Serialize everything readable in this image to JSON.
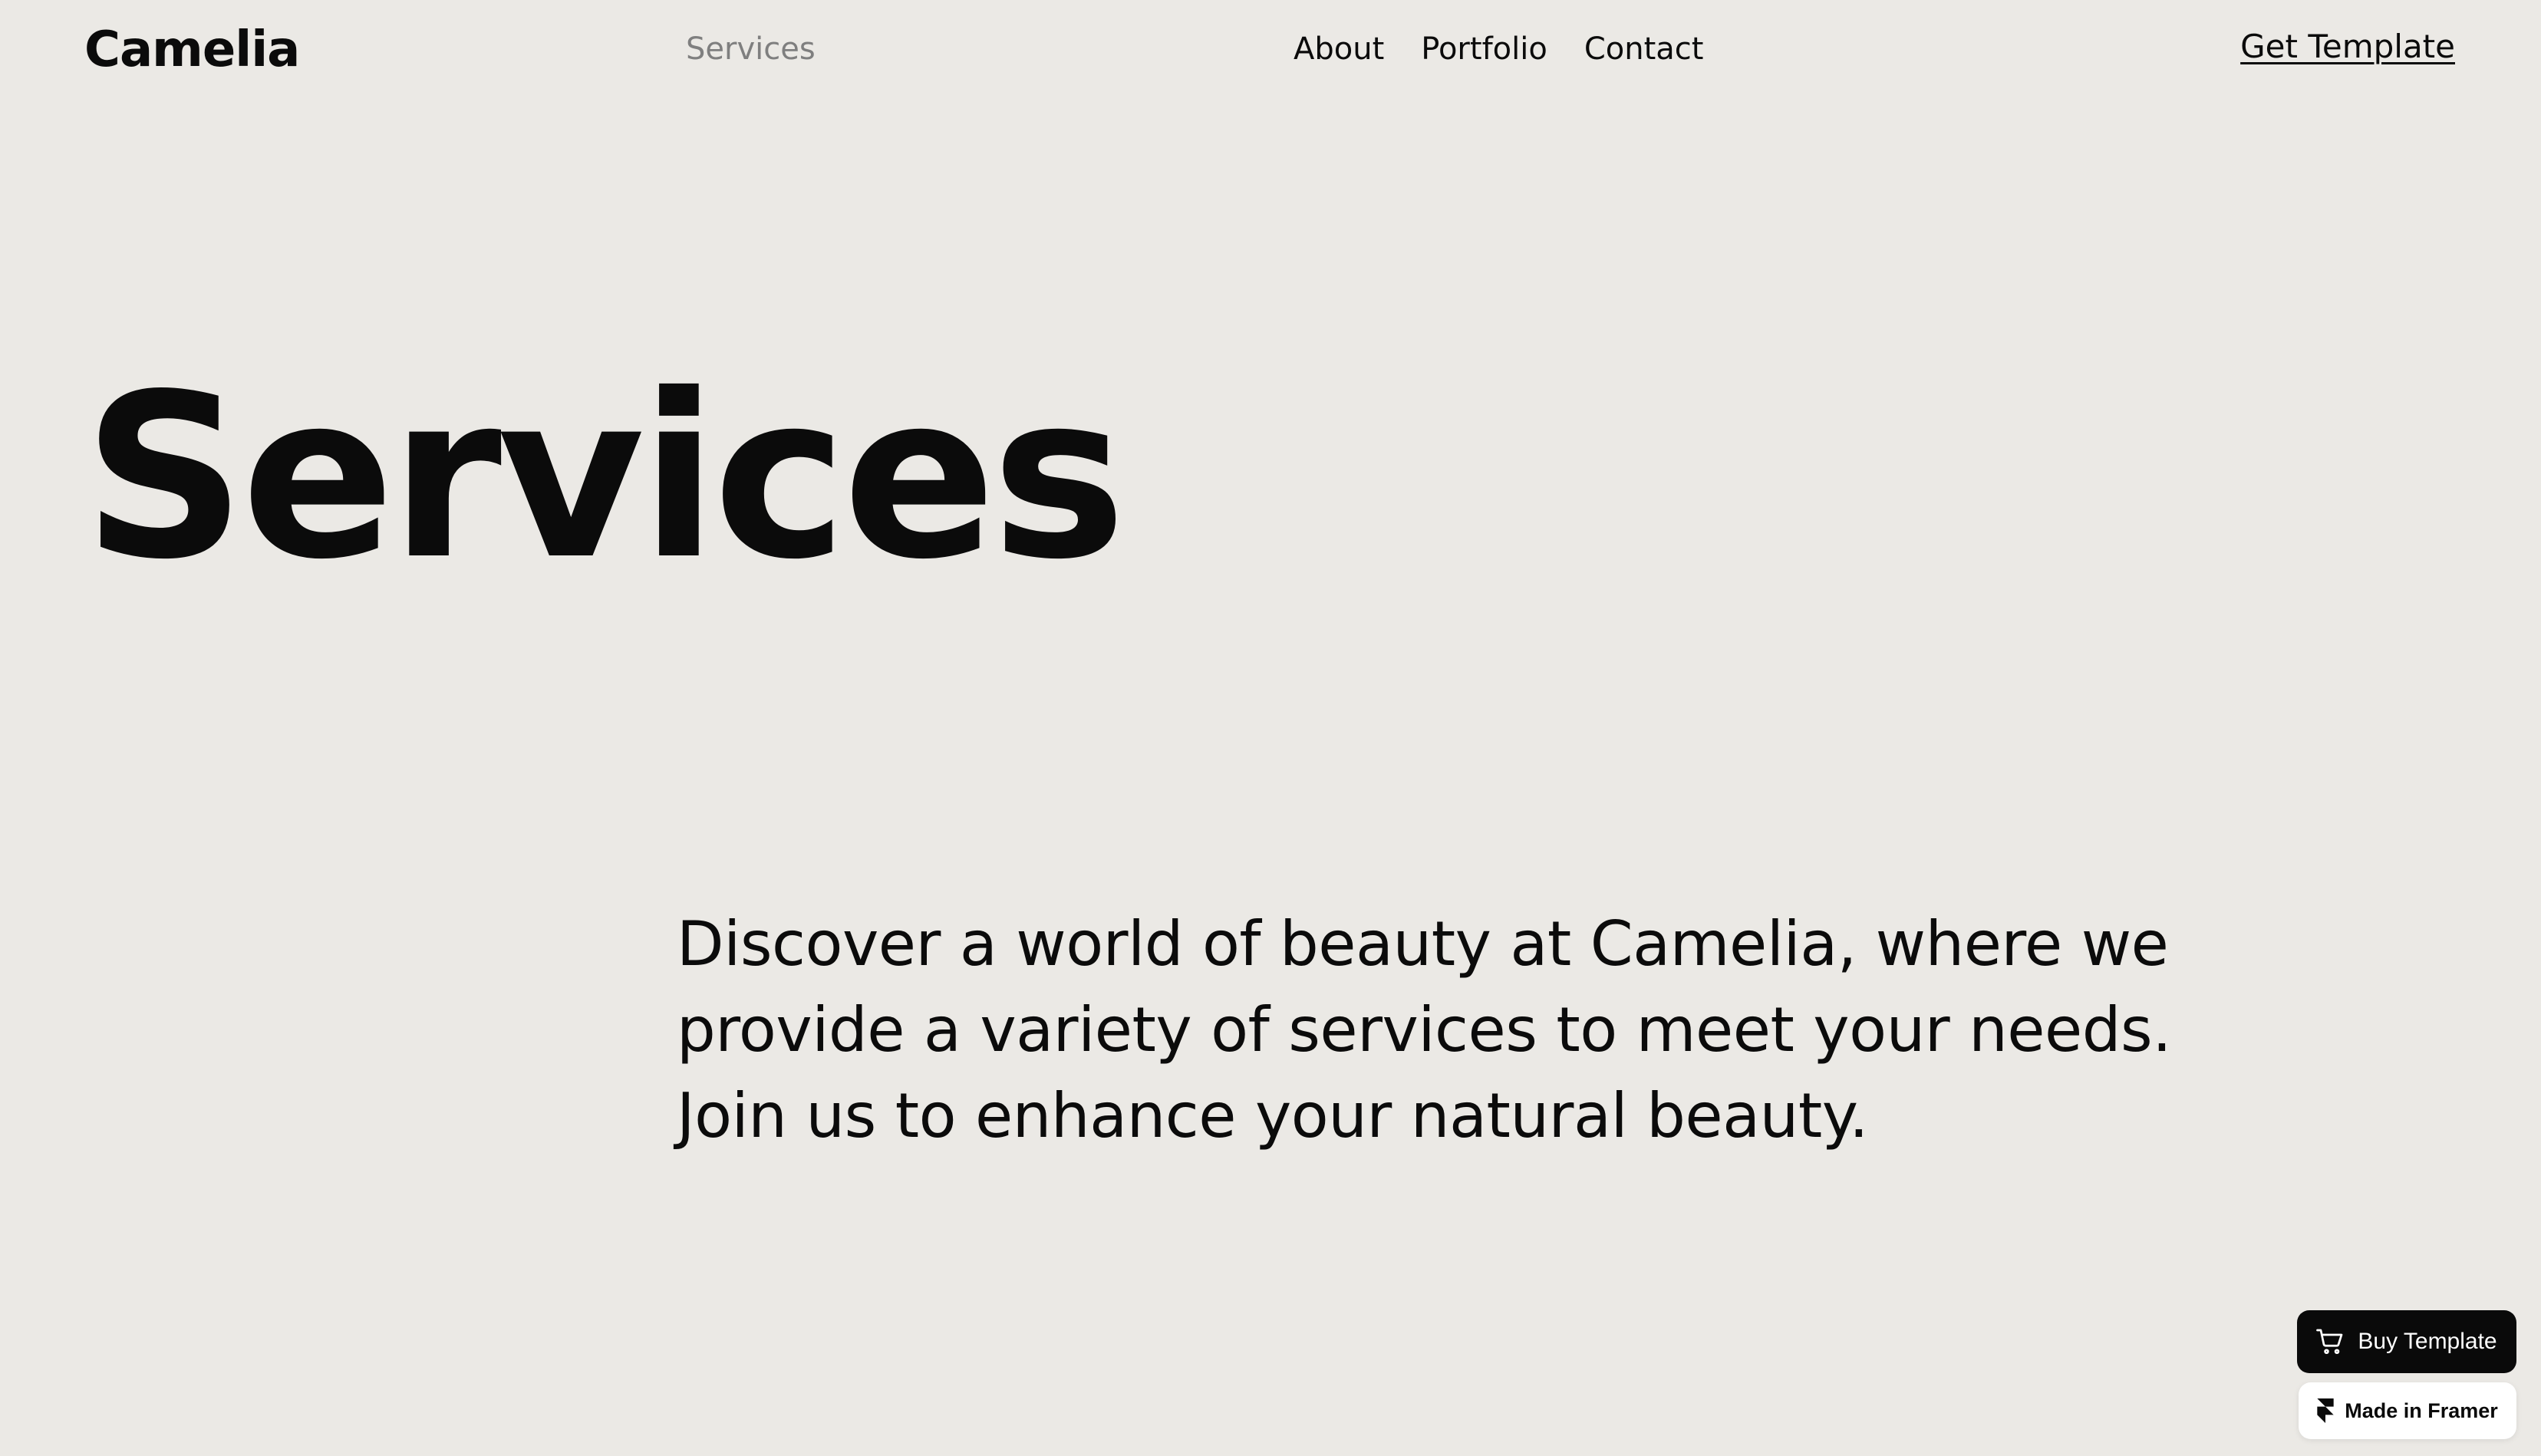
{
  "header": {
    "logo": "Camelia",
    "current_page": "Services",
    "nav": [
      {
        "label": "About"
      },
      {
        "label": "Portfolio"
      },
      {
        "label": "Contact"
      }
    ],
    "cta": "Get Template"
  },
  "hero": {
    "title": "Services",
    "intro": "Discover a world of beauty at Camelia, where we provide a variety of services to meet your needs. Join us to enhance your natural beauty."
  },
  "badges": {
    "buy_label": "Buy Template",
    "buy_icon": "cart-icon",
    "framer_label": "Made in Framer",
    "framer_icon": "framer-logo-icon"
  },
  "colors": {
    "background": "#ebe9e5",
    "text": "#0b0b0b",
    "muted_nav": "#7f7f7f",
    "buy_button_bg": "#0a0a0a",
    "framer_badge_bg": "#ffffff"
  }
}
